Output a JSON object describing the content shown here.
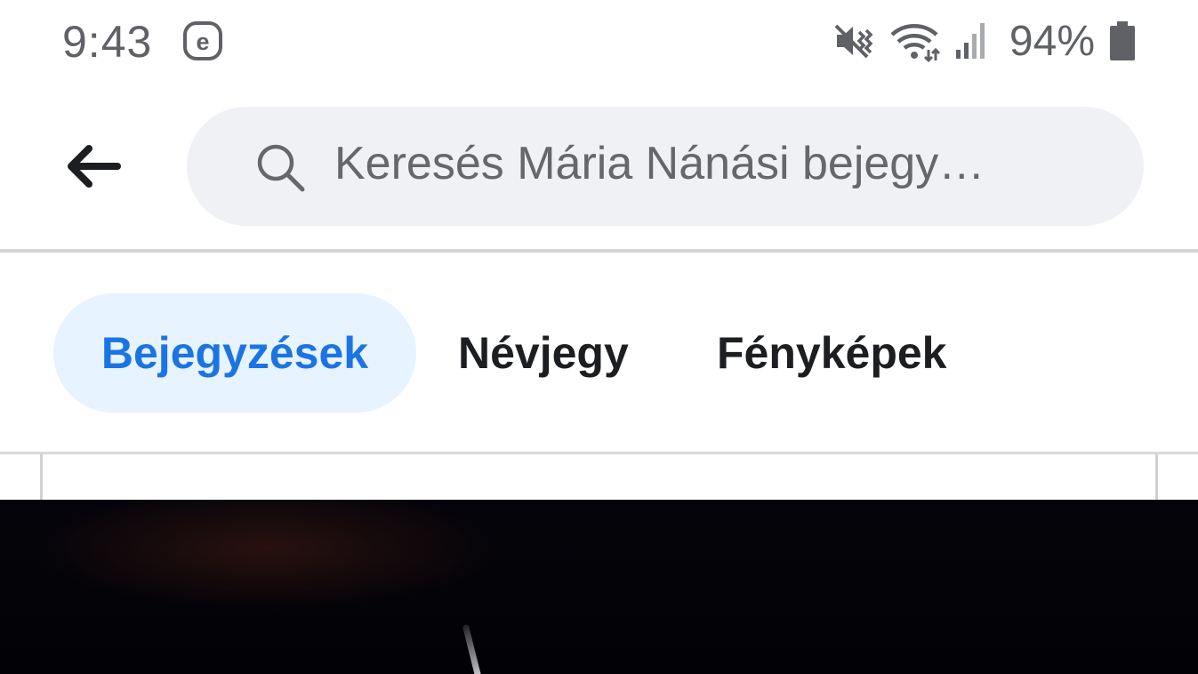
{
  "status_bar": {
    "time": "9:43",
    "app_icon": "e-circle-icon",
    "icons": [
      "mute-vibrate-icon",
      "wifi-icon",
      "signal-icon",
      "battery-icon"
    ],
    "battery": "94%"
  },
  "search": {
    "back_icon": "arrow-left-icon",
    "search_icon": "magnifier-icon",
    "placeholder": "Keresés Mária Nánási bejegy…"
  },
  "tabs": [
    {
      "label": "Bejegyzések",
      "active": true
    },
    {
      "label": "Névjegy",
      "active": false
    },
    {
      "label": "Fényképek",
      "active": false
    }
  ],
  "colors": {
    "accent": "#1b74e4",
    "active_tab_bg": "#e7f3ff",
    "search_bg": "#eff1f5",
    "status_text": "#5f6166"
  }
}
